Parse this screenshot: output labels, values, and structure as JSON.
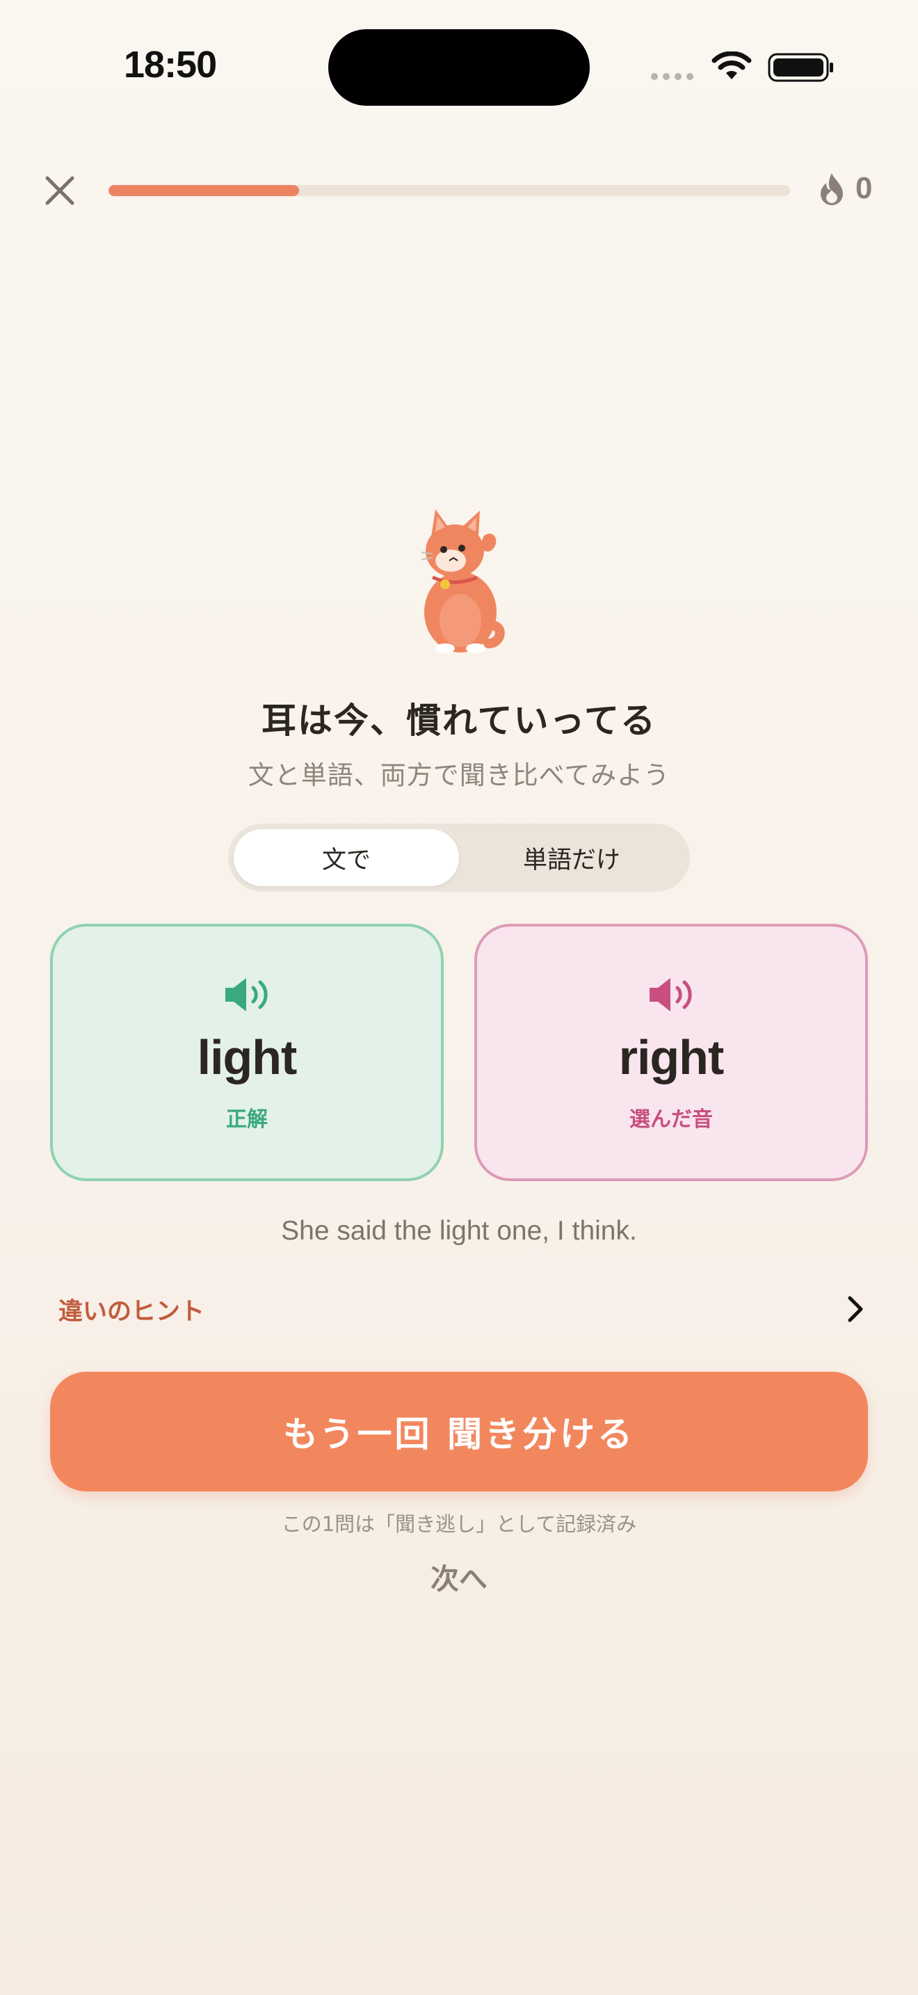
{
  "status_bar": {
    "time": "18:50"
  },
  "header": {
    "progress": 0.28,
    "streak_count": "0"
  },
  "mascot": {
    "name": "maneki-neko-cat"
  },
  "main": {
    "title": "耳は今、慣れていってる",
    "subtitle": "文と単語、両方で聞き比べてみよう",
    "segments": [
      {
        "label": "文で",
        "active": true
      },
      {
        "label": "単語だけ",
        "active": false
      }
    ],
    "cards": [
      {
        "word": "light",
        "tag": "正解",
        "color": "#3aa97d"
      },
      {
        "word": "right",
        "tag": "選んだ音",
        "color": "#c84f80"
      }
    ],
    "sentence": "She said the light one, I think.",
    "hint_label": "違いのヒント",
    "primary_button": "もう一回 聞き分ける",
    "note": "この1問は「聞き逃し」として記録済み",
    "next_label": "次へ"
  },
  "colors": {
    "accent": "#f2875e",
    "correct": "#3aa97d",
    "chosen": "#c84f80"
  }
}
